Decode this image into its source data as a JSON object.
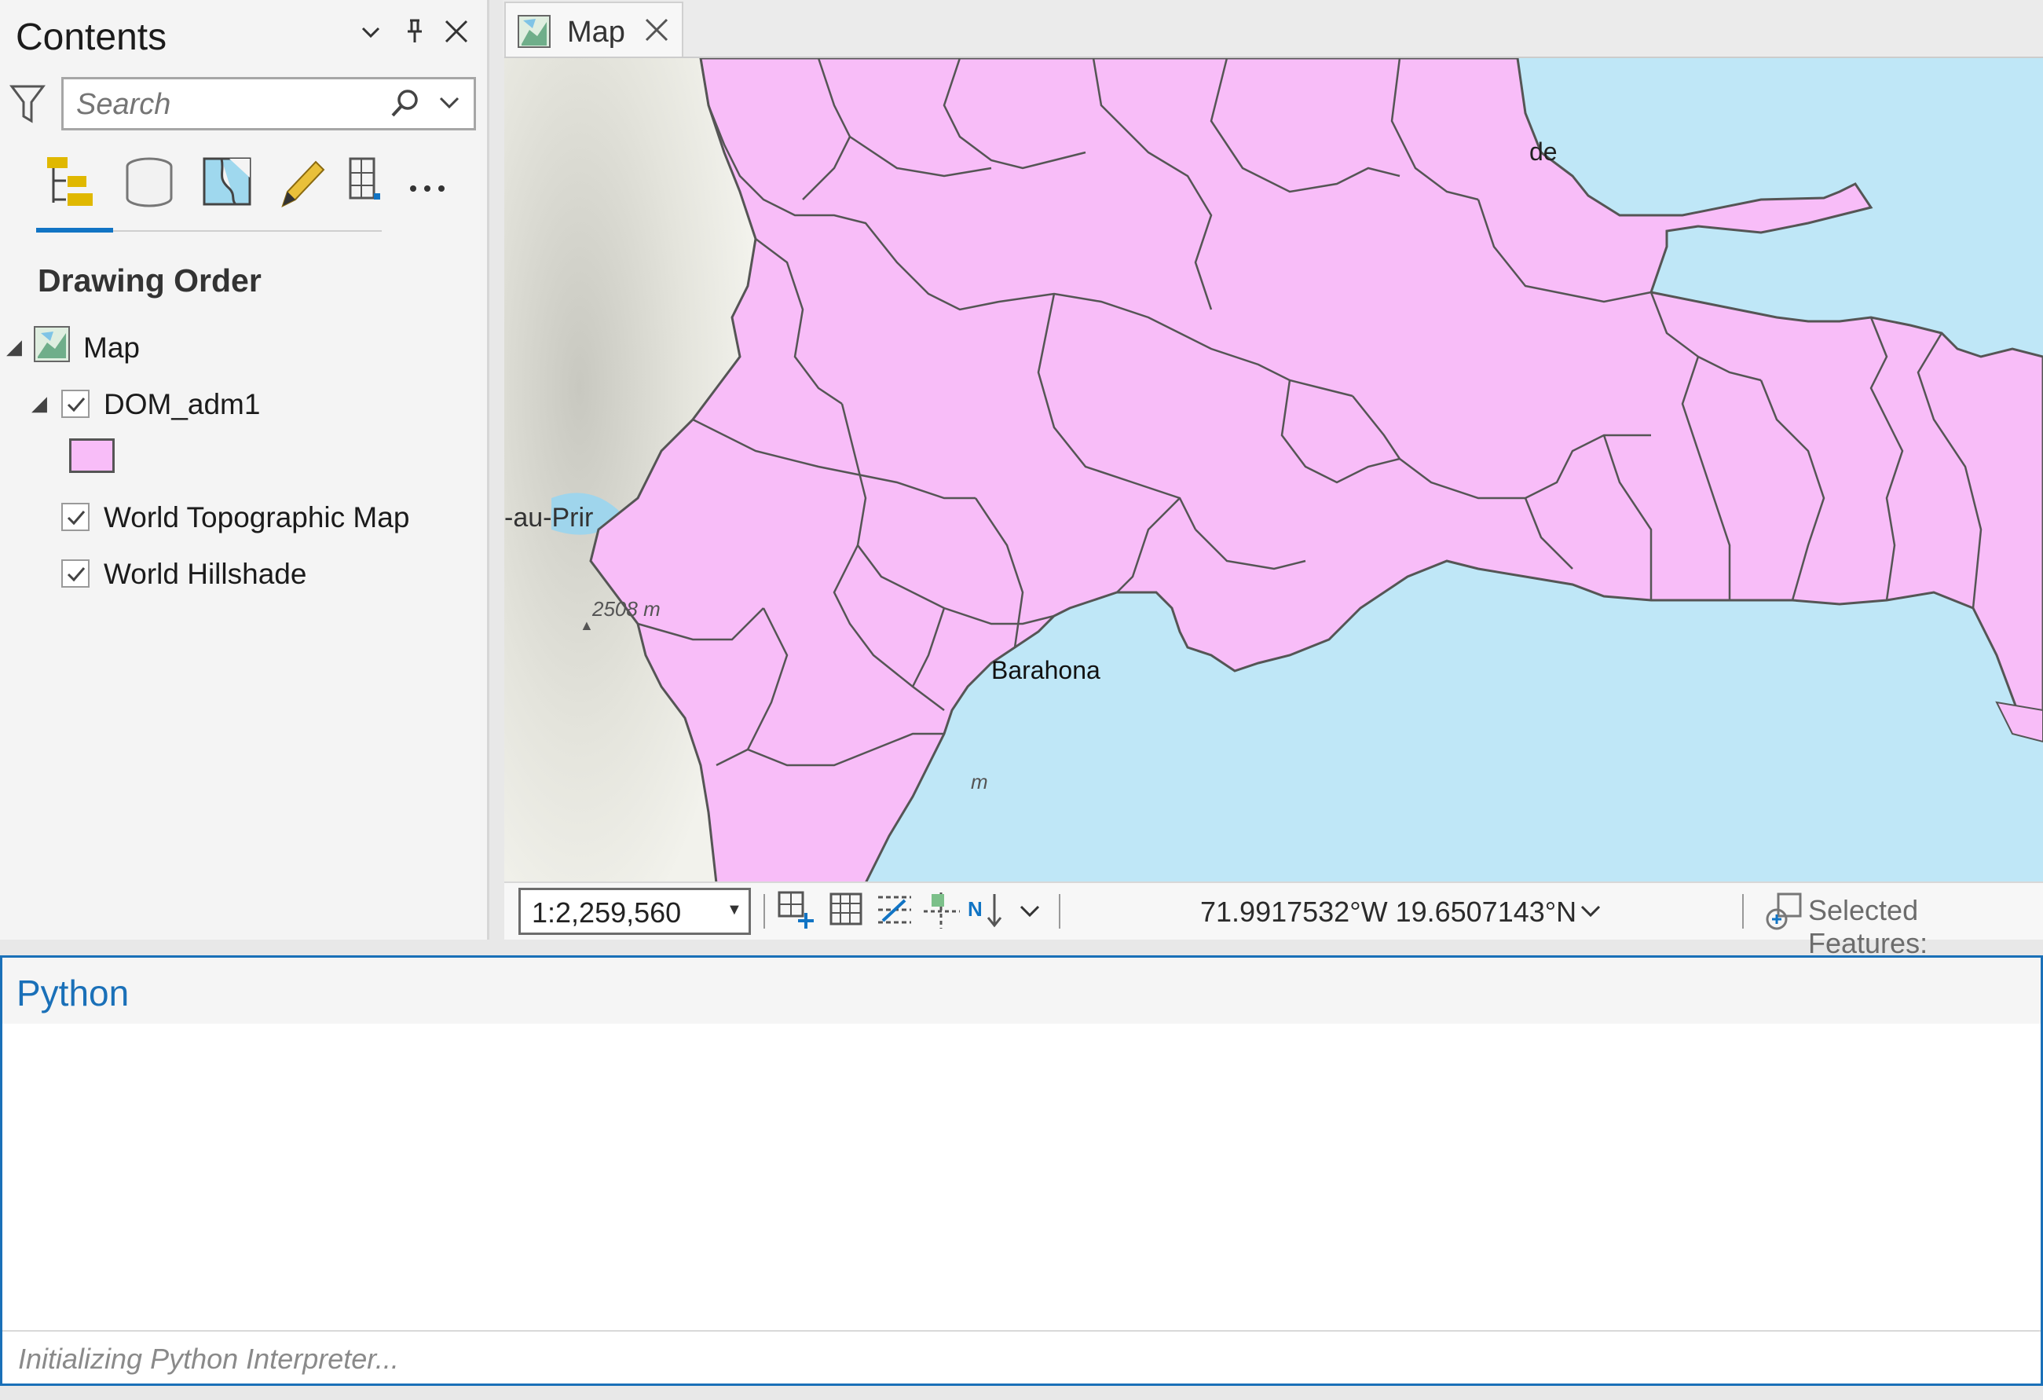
{
  "contents": {
    "title": "Contents",
    "search_placeholder": "Search",
    "section_title": "Drawing Order",
    "layers": [
      {
        "label": "Map",
        "type": "map"
      },
      {
        "label": "DOM_adm1",
        "checked": true,
        "swatch_color": "#f8bdf8"
      },
      {
        "label": "World Topographic Map",
        "checked": true
      },
      {
        "label": "World Hillshade",
        "checked": true
      }
    ]
  },
  "map_view": {
    "tab_label": "Map",
    "labels": {
      "place_1": "de",
      "place_2": "-au-Prir",
      "elevation": "2508 m",
      "city": "Barahona",
      "m_label": "m"
    },
    "colors": {
      "land_admin": "#f8bdf8",
      "water": "#bfe7f7",
      "border": "#555555"
    }
  },
  "status_bar": {
    "scale": "1:2,259,560",
    "coordinates": "71.9917532°W 19.6507143°N",
    "selected_features": "Selected Features:"
  },
  "python_pane": {
    "title": "Python",
    "status_text": "Initializing Python Interpreter..."
  }
}
